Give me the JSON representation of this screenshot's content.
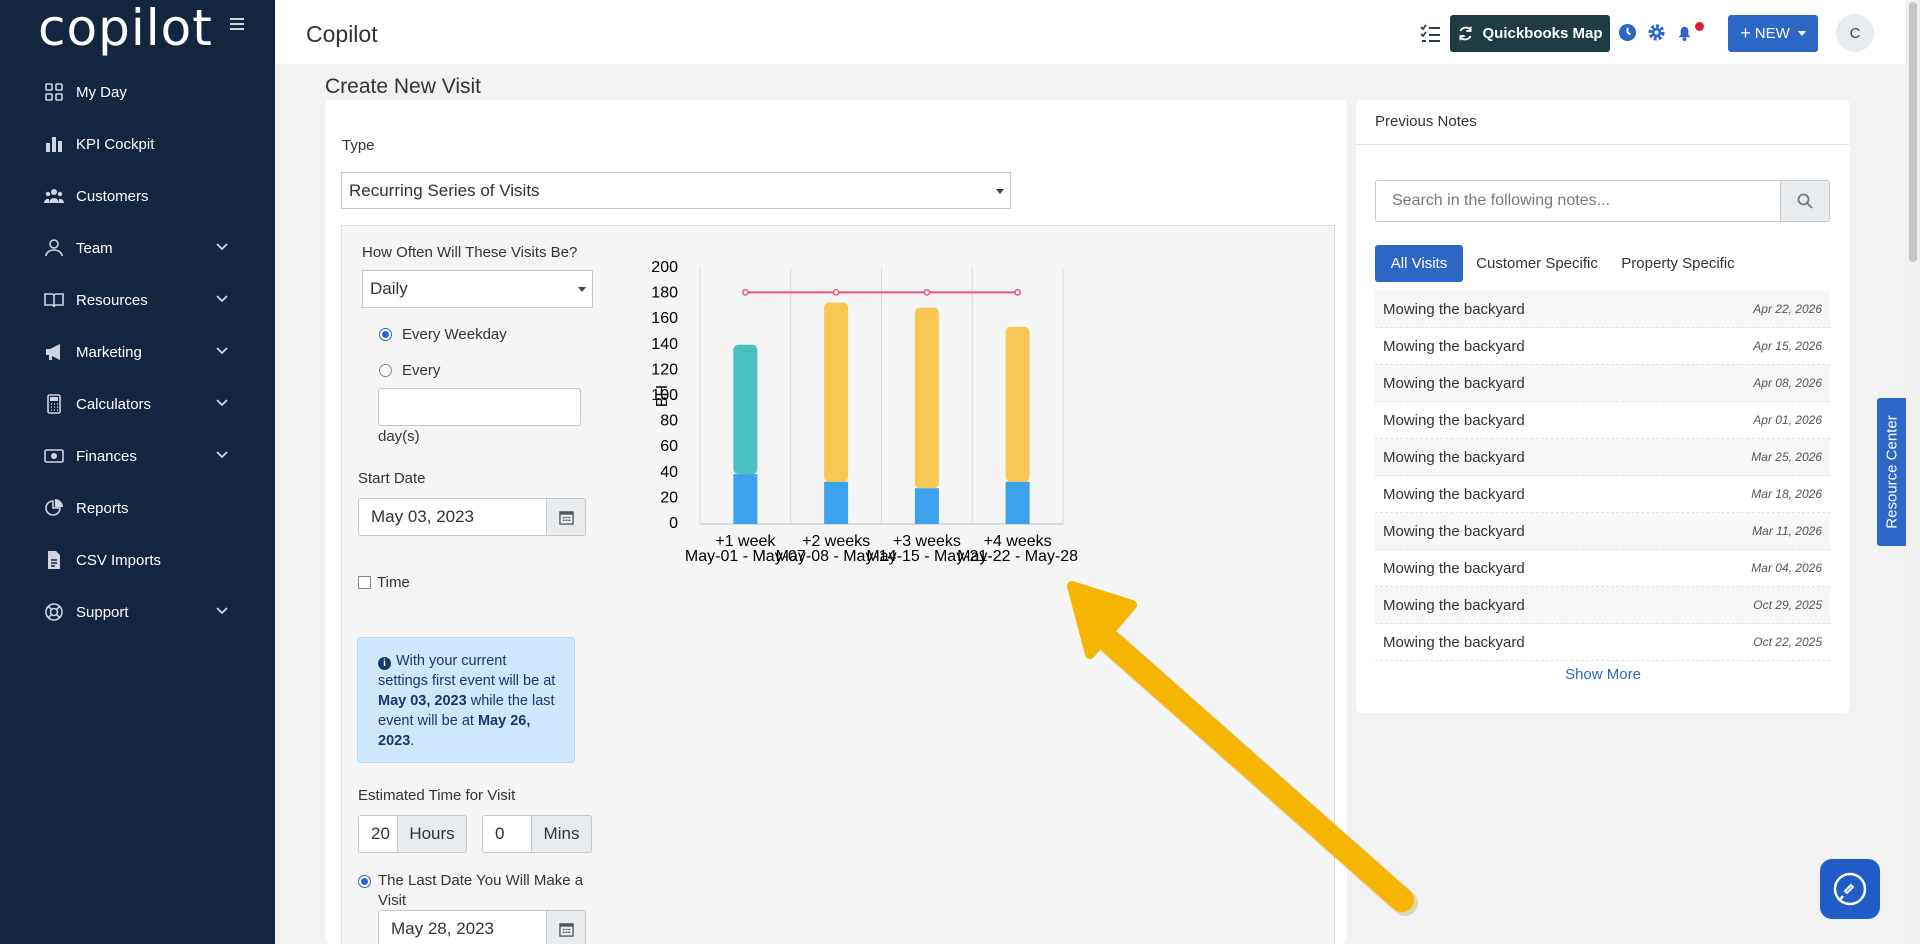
{
  "sidebar": {
    "logo": "copilot",
    "items": [
      {
        "label": "My Day",
        "icon": "grid-icon",
        "has_chevron": false
      },
      {
        "label": "KPI Cockpit",
        "icon": "bar-chart-icon",
        "has_chevron": false
      },
      {
        "label": "Customers",
        "icon": "users-icon",
        "has_chevron": false
      },
      {
        "label": "Team",
        "icon": "user-icon",
        "has_chevron": true
      },
      {
        "label": "Resources",
        "icon": "book-icon",
        "has_chevron": true
      },
      {
        "label": "Marketing",
        "icon": "megaphone-icon",
        "has_chevron": true
      },
      {
        "label": "Calculators",
        "icon": "calculator-icon",
        "has_chevron": true
      },
      {
        "label": "Finances",
        "icon": "money-icon",
        "has_chevron": true
      },
      {
        "label": "Reports",
        "icon": "pie-chart-icon",
        "has_chevron": false
      },
      {
        "label": "CSV Imports",
        "icon": "file-csv-icon",
        "has_chevron": false
      },
      {
        "label": "Support",
        "icon": "lifebuoy-icon",
        "has_chevron": true
      }
    ]
  },
  "header": {
    "title": "Copilot",
    "quickbooks_label": "Quickbooks Map",
    "new_label": "NEW",
    "avatar_initial": "C"
  },
  "page": {
    "title": "Create New Visit"
  },
  "form": {
    "type_label": "Type",
    "type_value": "Recurring Series of Visits",
    "frequency_label": "How Often Will These Visits Be?",
    "frequency_value": "Daily",
    "every_weekday_label": "Every Weekday",
    "every_label": "Every",
    "every_days_value": "",
    "days_label": "day(s)",
    "start_date_label": "Start Date",
    "start_date_value": "May 03, 2023",
    "time_label": "Time",
    "info": {
      "part1": "With your current settings first event will be at ",
      "first_date": "May 03, 2023",
      "part2": " while the last event will be at ",
      "last_date": "May 26, 2023",
      "part3": "."
    },
    "estimated_label": "Estimated Time for Visit",
    "hours_value": "20",
    "hours_label": "Hours",
    "mins_value": "0",
    "mins_label": "Mins",
    "last_date_option_label": "The Last Date You Will Make a Visit",
    "last_date_value": "May 28, 2023"
  },
  "chart_data": {
    "type": "bar",
    "stacked": true,
    "categories": [
      "+1 week",
      "+2 weeks",
      "+3 weeks",
      "+4 weeks"
    ],
    "category_sublabels": [
      "May-01 - May-07",
      "May-08 - May-14",
      "May-15 - May-21",
      "May-22 - May-28"
    ],
    "ylabel": "BH",
    "ylim": [
      0,
      200
    ],
    "yticks": [
      0,
      20,
      40,
      60,
      80,
      100,
      120,
      140,
      160,
      180,
      200
    ],
    "series": [
      {
        "values": [
          39,
          33,
          28,
          33
        ],
        "color": "#3da2ec"
      },
      {
        "values": [
          101,
          140,
          141,
          121
        ],
        "color": [
          "#47c0be",
          "#f9c853",
          "#f9c853",
          "#f9c853"
        ]
      }
    ],
    "line": {
      "values": [
        181,
        181,
        181,
        181
      ],
      "color": "#e8547a"
    }
  },
  "notes": {
    "title": "Previous Notes",
    "search_placeholder": "Search in the following notes...",
    "tabs": [
      "All Visits",
      "Customer Specific",
      "Property Specific"
    ],
    "items": [
      {
        "text": "Mowing the backyard",
        "date": "Apr 22, 2026"
      },
      {
        "text": "Mowing the backyard",
        "date": "Apr 15, 2026"
      },
      {
        "text": "Mowing the backyard",
        "date": "Apr 08, 2026"
      },
      {
        "text": "Mowing the backyard",
        "date": "Apr 01, 2026"
      },
      {
        "text": "Mowing the backyard",
        "date": "Mar 25, 2026"
      },
      {
        "text": "Mowing the backyard",
        "date": "Mar 18, 2026"
      },
      {
        "text": "Mowing the backyard",
        "date": "Mar 11, 2026"
      },
      {
        "text": "Mowing the backyard",
        "date": "Mar 04, 2026"
      },
      {
        "text": "Mowing the backyard",
        "date": "Oct 29, 2025"
      },
      {
        "text": "Mowing the backyard",
        "date": "Oct 22, 2025"
      }
    ],
    "show_more": "Show More"
  },
  "resource_center_label": "Resource Center",
  "colors": {
    "sidebar_bg": "#13253f",
    "primary": "#2d67c6",
    "quickbooks_bg": "#1f3c45",
    "annotation_arrow": "#f6b500"
  }
}
